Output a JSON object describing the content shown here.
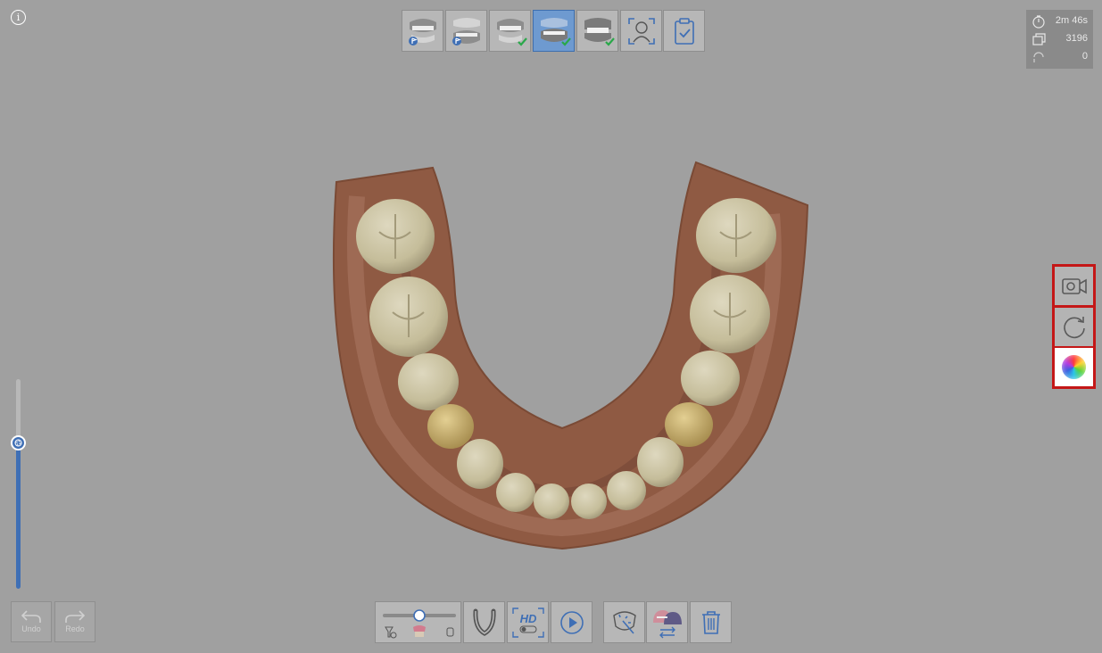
{
  "info": {
    "label": "i"
  },
  "stages": [
    {
      "name": "maxilla-stage",
      "icon": "upper-jaw-icon",
      "active": false,
      "badge": "flag"
    },
    {
      "name": "mandible-stage",
      "icon": "lower-jaw-icon",
      "active": false,
      "badge": "flag"
    },
    {
      "name": "upper-jaw-complete-stage",
      "icon": "upper-jaw-icon",
      "active": false,
      "badge": "check"
    },
    {
      "name": "lower-jaw-stage",
      "icon": "lower-jaw-icon",
      "active": true,
      "badge": "check"
    },
    {
      "name": "occlusion-stage",
      "icon": "occlusion-icon",
      "active": false,
      "badge": "check"
    },
    {
      "name": "face-scan-stage",
      "icon": "face-scan-icon",
      "active": false
    },
    {
      "name": "review-stage",
      "icon": "clipboard-check-icon",
      "active": false
    }
  ],
  "stats": {
    "time": "2m 46s",
    "frames": "3196",
    "deleted": "0"
  },
  "right_tools": [
    {
      "name": "video-record",
      "icon": "video-camera-icon"
    },
    {
      "name": "reset-view",
      "icon": "refresh-icon"
    },
    {
      "name": "color-map",
      "icon": "color-wheel-icon"
    }
  ],
  "history": {
    "undo_label": "Undo",
    "redo_label": "Redo"
  },
  "depth_slider": {
    "value": 0.7
  },
  "bottom_toolbar": [
    {
      "name": "filter-slider",
      "icon": "filter-slider-icon"
    },
    {
      "name": "arch-mode",
      "icon": "arch-icon"
    },
    {
      "name": "hd-mode",
      "icon": "hd-icon",
      "label": "HD"
    },
    {
      "name": "play",
      "icon": "play-icon"
    },
    {
      "name": "smart-selection",
      "icon": "smart-selection-icon"
    },
    {
      "name": "jaw-switch",
      "icon": "jaw-switch-icon"
    },
    {
      "name": "delete",
      "icon": "trash-icon"
    }
  ],
  "colors": {
    "background": "#a0a0a0",
    "accent": "#3f6fb5",
    "highlight": "#c41717",
    "check": "#2aa84a"
  }
}
